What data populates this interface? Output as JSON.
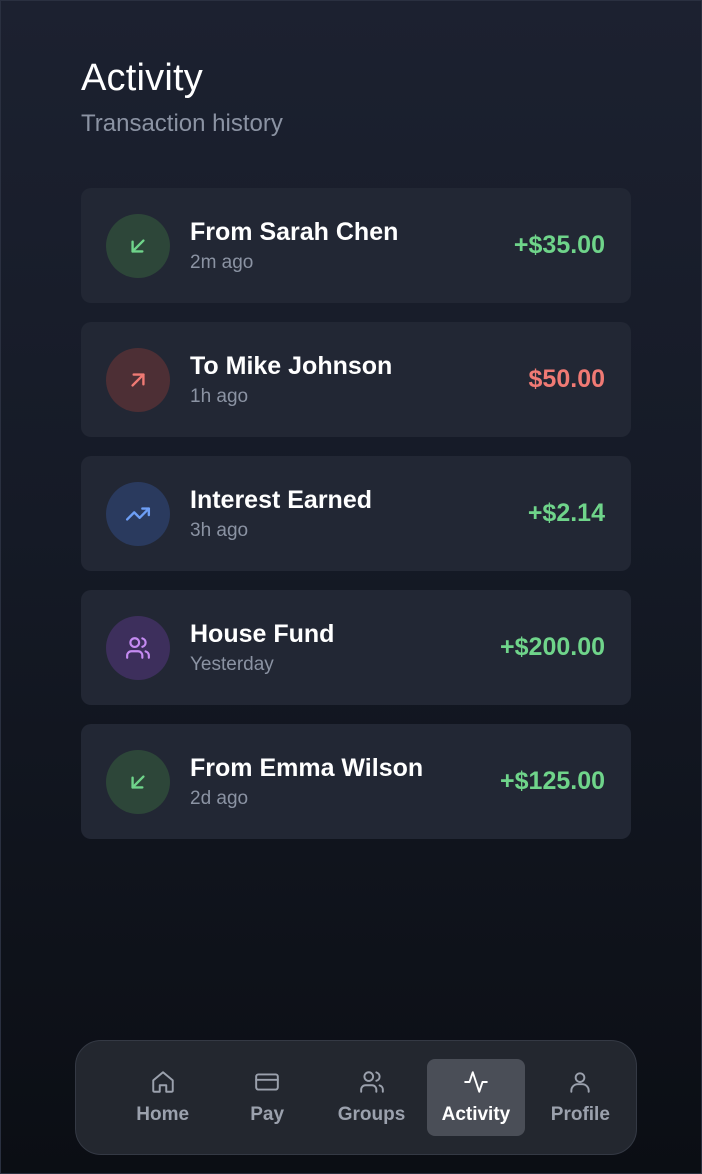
{
  "header": {
    "title": "Activity",
    "subtitle": "Transaction history"
  },
  "colors": {
    "positive": "#6fd48a",
    "negative": "#f07a74",
    "incoming_bg": "#2d4639",
    "outgoing_bg": "#4d2f35",
    "interest_bg": "#2a3a5e",
    "group_bg": "#3d2f5c",
    "interest_icon": "#6d9ef5",
    "group_icon": "#c58bf2"
  },
  "transactions": [
    {
      "title": "From Sarah Chen",
      "time": "2m ago",
      "amount": "+$35.00",
      "type": "incoming",
      "icon": "arrow-down-left-icon"
    },
    {
      "title": "To Mike Johnson",
      "time": "1h ago",
      "amount": "$50.00",
      "type": "outgoing",
      "icon": "arrow-up-right-icon"
    },
    {
      "title": "Interest Earned",
      "time": "3h ago",
      "amount": "+$2.14",
      "type": "interest",
      "icon": "trending-up-icon"
    },
    {
      "title": "House Fund",
      "time": "Yesterday",
      "amount": "+$200.00",
      "type": "group",
      "icon": "users-icon"
    },
    {
      "title": "From Emma Wilson",
      "time": "2d ago",
      "amount": "+$125.00",
      "type": "incoming",
      "icon": "arrow-down-left-icon"
    }
  ],
  "nav": {
    "active": "Activity",
    "items": [
      {
        "label": "Home",
        "icon": "home-icon"
      },
      {
        "label": "Pay",
        "icon": "credit-card-icon"
      },
      {
        "label": "Groups",
        "icon": "users-icon"
      },
      {
        "label": "Activity",
        "icon": "activity-icon"
      },
      {
        "label": "Profile",
        "icon": "user-icon"
      }
    ]
  }
}
